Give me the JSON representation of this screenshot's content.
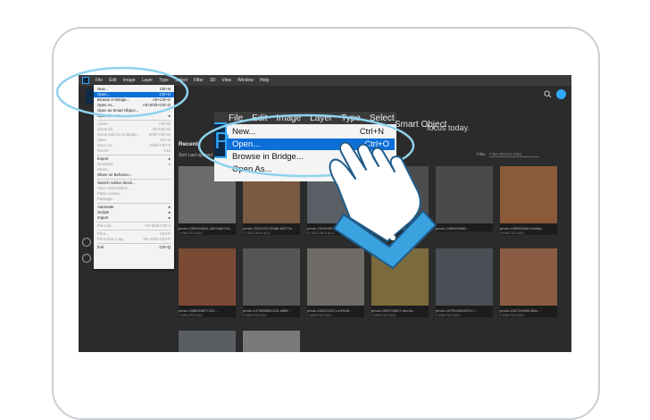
{
  "menubar": [
    "File",
    "Edit",
    "Image",
    "Layer",
    "Type",
    "Select",
    "Filter",
    "3D",
    "View",
    "Window",
    "Help"
  ],
  "home": {
    "title_fragment": "focus today.",
    "recent_label": "Recent",
    "sort_label": "Sort",
    "sort_value": "Last opened",
    "filter_label": "Filter",
    "filter_placeholder": "Filter Recent Files"
  },
  "file_menu": [
    {
      "label": "New...",
      "shortcut": "Ctrl+N",
      "state": "normal"
    },
    {
      "label": "Open...",
      "shortcut": "Ctrl+O",
      "state": "highlight"
    },
    {
      "label": "Browse in Bridge...",
      "shortcut": "Alt+Ctrl+O",
      "state": "normal"
    },
    {
      "label": "Open As...",
      "shortcut": "Alt+Shift+Ctrl+O",
      "state": "normal"
    },
    {
      "label": "Open as Smart Object...",
      "shortcut": "",
      "state": "normal"
    },
    {
      "label": "Open Recent",
      "shortcut": "▸",
      "state": "normal"
    },
    {
      "sep": true
    },
    {
      "label": "Close",
      "shortcut": "Ctrl+W",
      "state": "disabled"
    },
    {
      "label": "Close All",
      "shortcut": "Alt+Ctrl+W",
      "state": "disabled"
    },
    {
      "label": "Close and Go to Bridge...",
      "shortcut": "Shift+Ctrl+W",
      "state": "disabled"
    },
    {
      "label": "Save",
      "shortcut": "Ctrl+S",
      "state": "disabled"
    },
    {
      "label": "Save As...",
      "shortcut": "Shift+Ctrl+S",
      "state": "disabled"
    },
    {
      "label": "Revert",
      "shortcut": "F12",
      "state": "disabled"
    },
    {
      "sep": true
    },
    {
      "label": "Export",
      "shortcut": "▸",
      "state": "normal"
    },
    {
      "label": "Generate",
      "shortcut": "▸",
      "state": "disabled"
    },
    {
      "label": "Share...",
      "shortcut": "",
      "state": "disabled"
    },
    {
      "label": "Share on Behance...",
      "shortcut": "",
      "state": "normal"
    },
    {
      "sep": true
    },
    {
      "label": "Search Adobe Stock...",
      "shortcut": "",
      "state": "normal"
    },
    {
      "label": "Place Embedded...",
      "shortcut": "",
      "state": "disabled"
    },
    {
      "label": "Place Linked...",
      "shortcut": "",
      "state": "disabled"
    },
    {
      "label": "Package...",
      "shortcut": "",
      "state": "disabled"
    },
    {
      "sep": true
    },
    {
      "label": "Automate",
      "shortcut": "▸",
      "state": "normal"
    },
    {
      "label": "Scripts",
      "shortcut": "▸",
      "state": "normal"
    },
    {
      "label": "Import",
      "shortcut": "▸",
      "state": "normal"
    },
    {
      "sep": true
    },
    {
      "label": "File Info...",
      "shortcut": "Alt+Shift+Ctrl+I",
      "state": "disabled"
    },
    {
      "sep": true
    },
    {
      "label": "Print...",
      "shortcut": "Ctrl+P",
      "state": "disabled"
    },
    {
      "label": "Print One Copy",
      "shortcut": "Alt+Shift+Ctrl+P",
      "state": "disabled"
    },
    {
      "sep": true
    },
    {
      "label": "Exit",
      "shortcut": "Ctrl+Q",
      "state": "normal"
    }
  ],
  "zoom_menu": {
    "bar": [
      "File",
      "Edit",
      "Image",
      "Layer",
      "Type",
      "Select"
    ],
    "items": [
      {
        "label": "New...",
        "shortcut": "Ctrl+N",
        "highlight": false
      },
      {
        "label": "Open...",
        "shortcut": "Ctrl+O",
        "highlight": true
      },
      {
        "label": "Browse in Bridge...",
        "shortcut": "",
        "highlight": false
      },
      {
        "label": "Open As...",
        "shortcut": "Alt+S",
        "highlight": false
      }
    ],
    "tail_text": "Smart Object"
  },
  "thumbnails": [
    {
      "name": "photo-1552493051-3847a0b7e3...",
      "ago": "1 MINUTES AGO",
      "tone": "#6b6b6b"
    },
    {
      "name": "photo-1522202176988-66273c...",
      "ago": "12 SECONDS AGO",
      "tone": "#7a5a40"
    },
    {
      "name": "photo-1519345718-b1ad5f0d...",
      "ago": "10 SECONDS AGO",
      "tone": "#5a5f66"
    },
    {
      "name": "photo-1551019080-80e6b...",
      "ago": "9 SECONDS AGO",
      "tone": "#4d4d4d"
    },
    {
      "name": "photo-1485893086...",
      "ago": "",
      "tone": "#4a4a4a"
    },
    {
      "name": "photo-1569551853-b9a8a...",
      "ago": "4 MINUTES AGO",
      "tone": "#8a5a3a"
    },
    {
      "name": "photo-1566359877222-...",
      "ago": "1 MINUTES AGO",
      "tone": "#7a4a35"
    },
    {
      "name": "photo-1473655551229-a3f6f...",
      "ago": "3 MINUTES AGO",
      "tone": "#555555"
    },
    {
      "name": "photo-1522202471-e45c5f...",
      "ago": "1 MINUTES AGO",
      "tone": "#6e6a66"
    },
    {
      "name": "photo-1553708917-dec3a...",
      "ago": "4 MINUTES AGO",
      "tone": "#7b6a3c"
    },
    {
      "name": "photo-1579544044574-f...",
      "ago": "2 MINUTES AGO",
      "tone": "#4a4f55"
    },
    {
      "name": "photo-1547234935-80a...",
      "ago": "2 MINUTES AGO",
      "tone": "#8a5c44"
    },
    {
      "name": "photo-1581719...",
      "ago": "3 MINUTES AGO",
      "tone": "#5a5e62"
    },
    {
      "name": "photo-1531572753-bab...",
      "ago": "8 DAYS AGO",
      "tone": "#7a7a7a"
    }
  ],
  "colors": {
    "accent": "#31a8ff",
    "highlight": "#0d6fd8",
    "ring": "#8fd3ee",
    "app_bg": "#2b2b2b"
  },
  "icons": [
    "ps-logo-icon",
    "search-icon",
    "avatar-icon",
    "grid-view-icon",
    "list-view-icon",
    "hand-pointer-icon"
  ]
}
